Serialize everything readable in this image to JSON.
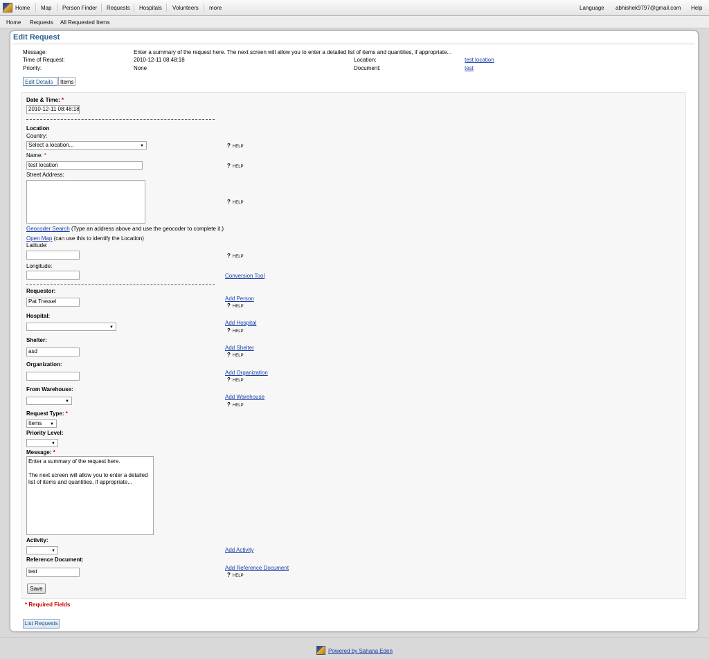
{
  "nav": {
    "home": "Home",
    "map": "Map",
    "person_finder": "Person Finder",
    "requests": "Requests",
    "hospitals": "Hospitals",
    "volunteers": "Volunteers",
    "more": "more",
    "language": "Language",
    "user": "abhishek9797@gmail.com",
    "help": "Help"
  },
  "subnav": {
    "home": "Home",
    "requests": "Requests",
    "all_items": "All Requested Items"
  },
  "page": {
    "title": "Edit Request"
  },
  "summary": {
    "message_label": "Message:",
    "message_value": "Enter a summary of the request here. The next screen will allow you to enter a detailed list of items and quantities, if appropriate...",
    "time_label": "Time of Request:",
    "time_value": "2010-12-11 08:48:18",
    "priority_label": "Priority:",
    "priority_value": "None",
    "location_label": "Location:",
    "location_value": "test location",
    "document_label": "Document:",
    "document_value": "test"
  },
  "tabs": {
    "edit_details": "Edit Details",
    "items": "Items"
  },
  "form": {
    "datetime_label": "Date & Time:",
    "datetime_value": "2010-12-11 08:48:18",
    "location_heading": "Location",
    "country_label": "Country:",
    "country_value": "Select a location...",
    "name_label": "Name:",
    "name_value": "test location",
    "street_label": "Street Address:",
    "geocoder_link": "Geocoder Search",
    "geocoder_hint": "(Type an address above and use the geocoder to complete it.)",
    "openmap_link": "Open Map",
    "openmap_hint": "(can use this to identify the Location)",
    "latitude_label": "Latitude:",
    "longitude_label": "Longitude:",
    "conversion_tool": "Conversion Tool",
    "requestor_label": "Requestor:",
    "requestor_value": "Pat Tressel",
    "add_person": "Add Person",
    "hospital_label": "Hospital:",
    "add_hospital": "Add Hospital",
    "shelter_label": "Shelter:",
    "shelter_value": "asd",
    "add_shelter": "Add Shelter",
    "organization_label": "Organization:",
    "add_organization": "Add Organization",
    "warehouse_label": "From Warehouse:",
    "add_warehouse": "Add Warehouse",
    "request_type_label": "Request Type:",
    "request_type_value": "Items",
    "priority_level_label": "Priority Level:",
    "message_label": "Message:",
    "message_value": "Enter a summary of the request here.\n\nThe next screen will allow you to enter a detailed list of items and quantities, if appropriate...",
    "activity_label": "Activity:",
    "add_activity": "Add Activity",
    "ref_doc_label": "Reference Document:",
    "ref_doc_value": "test",
    "add_ref_doc": "Add Reference Document",
    "help": "HELP",
    "help_q": "?",
    "required_star": "*",
    "save": "Save",
    "required_note": "* Required Fields",
    "list_requests": "List Requests"
  },
  "footer": {
    "powered": "Powered by Sahana Eden"
  }
}
